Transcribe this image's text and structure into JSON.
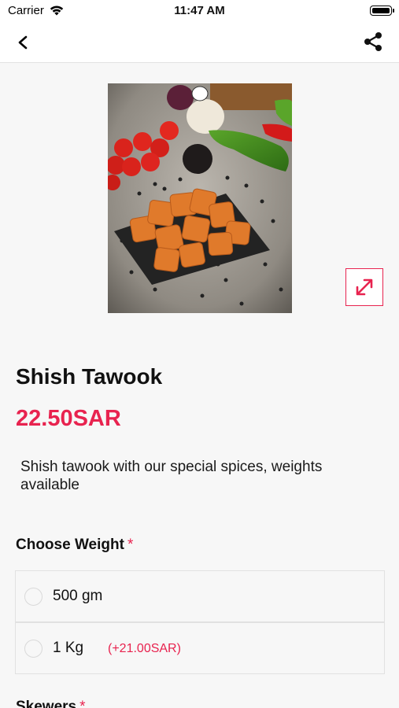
{
  "status_bar": {
    "carrier": "Carrier",
    "time": "11:47 AM"
  },
  "nav": {
    "back_icon": "chevron-left-icon",
    "share_icon": "share-icon"
  },
  "product": {
    "image_alt": "Shish Tawook",
    "title": "Shish Tawook",
    "price": "22.50SAR",
    "description": "Shish tawook with our special spices, weights available",
    "expand_icon": "expand-arrows-icon"
  },
  "weight_section": {
    "title": "Choose Weight",
    "required_mark": "*",
    "options": [
      {
        "label": "500 gm",
        "extra": ""
      },
      {
        "label": "1 Kg",
        "extra": "(+21.00SAR)"
      }
    ]
  },
  "skewers_section": {
    "title": "Skewers",
    "required_mark": "*"
  },
  "colors": {
    "accent": "#e8234f",
    "background": "#f7f7f7"
  }
}
